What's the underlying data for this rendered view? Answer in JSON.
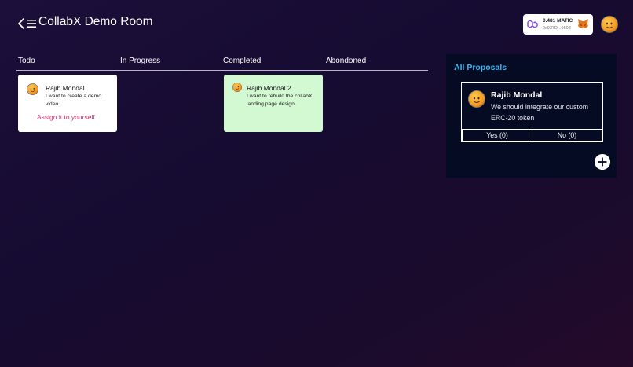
{
  "header": {
    "title": "CollabX Demo Room",
    "back_icon": "chevron-left-icon",
    "menu_icon": "hamburger-menu-icon"
  },
  "wallet": {
    "balance": "0.481 MATIC",
    "address": "0x937D...9608",
    "network_icon": "polygon-icon",
    "wallet_icon": "metamask-fox-icon"
  },
  "board": {
    "columns": [
      "Todo",
      "In Progress",
      "Completed",
      "Abondoned"
    ],
    "cards": [
      {
        "column": "Todo",
        "name": "Rajib Mondal",
        "description": "I want to create a demo video",
        "action": "Assign it to yourself",
        "background": "#ffffff"
      },
      {
        "column": "Completed",
        "name": "Rajib Mondal 2",
        "description": "I want to rebuild the collabX landing page design.",
        "background": "#d2f9d2"
      }
    ]
  },
  "proposals": {
    "title": "All Proposals",
    "items": [
      {
        "name": "Rajib Mondal",
        "text": "We should integrate our custom ERC-20 token",
        "yes_label": "Yes (0)",
        "no_label": "No (0)"
      }
    ],
    "add_icon": "plus-icon"
  },
  "colors": {
    "accent_blue": "#38b7f0",
    "assign_pink": "#d52e6d",
    "panel_bg": "#060b24"
  }
}
